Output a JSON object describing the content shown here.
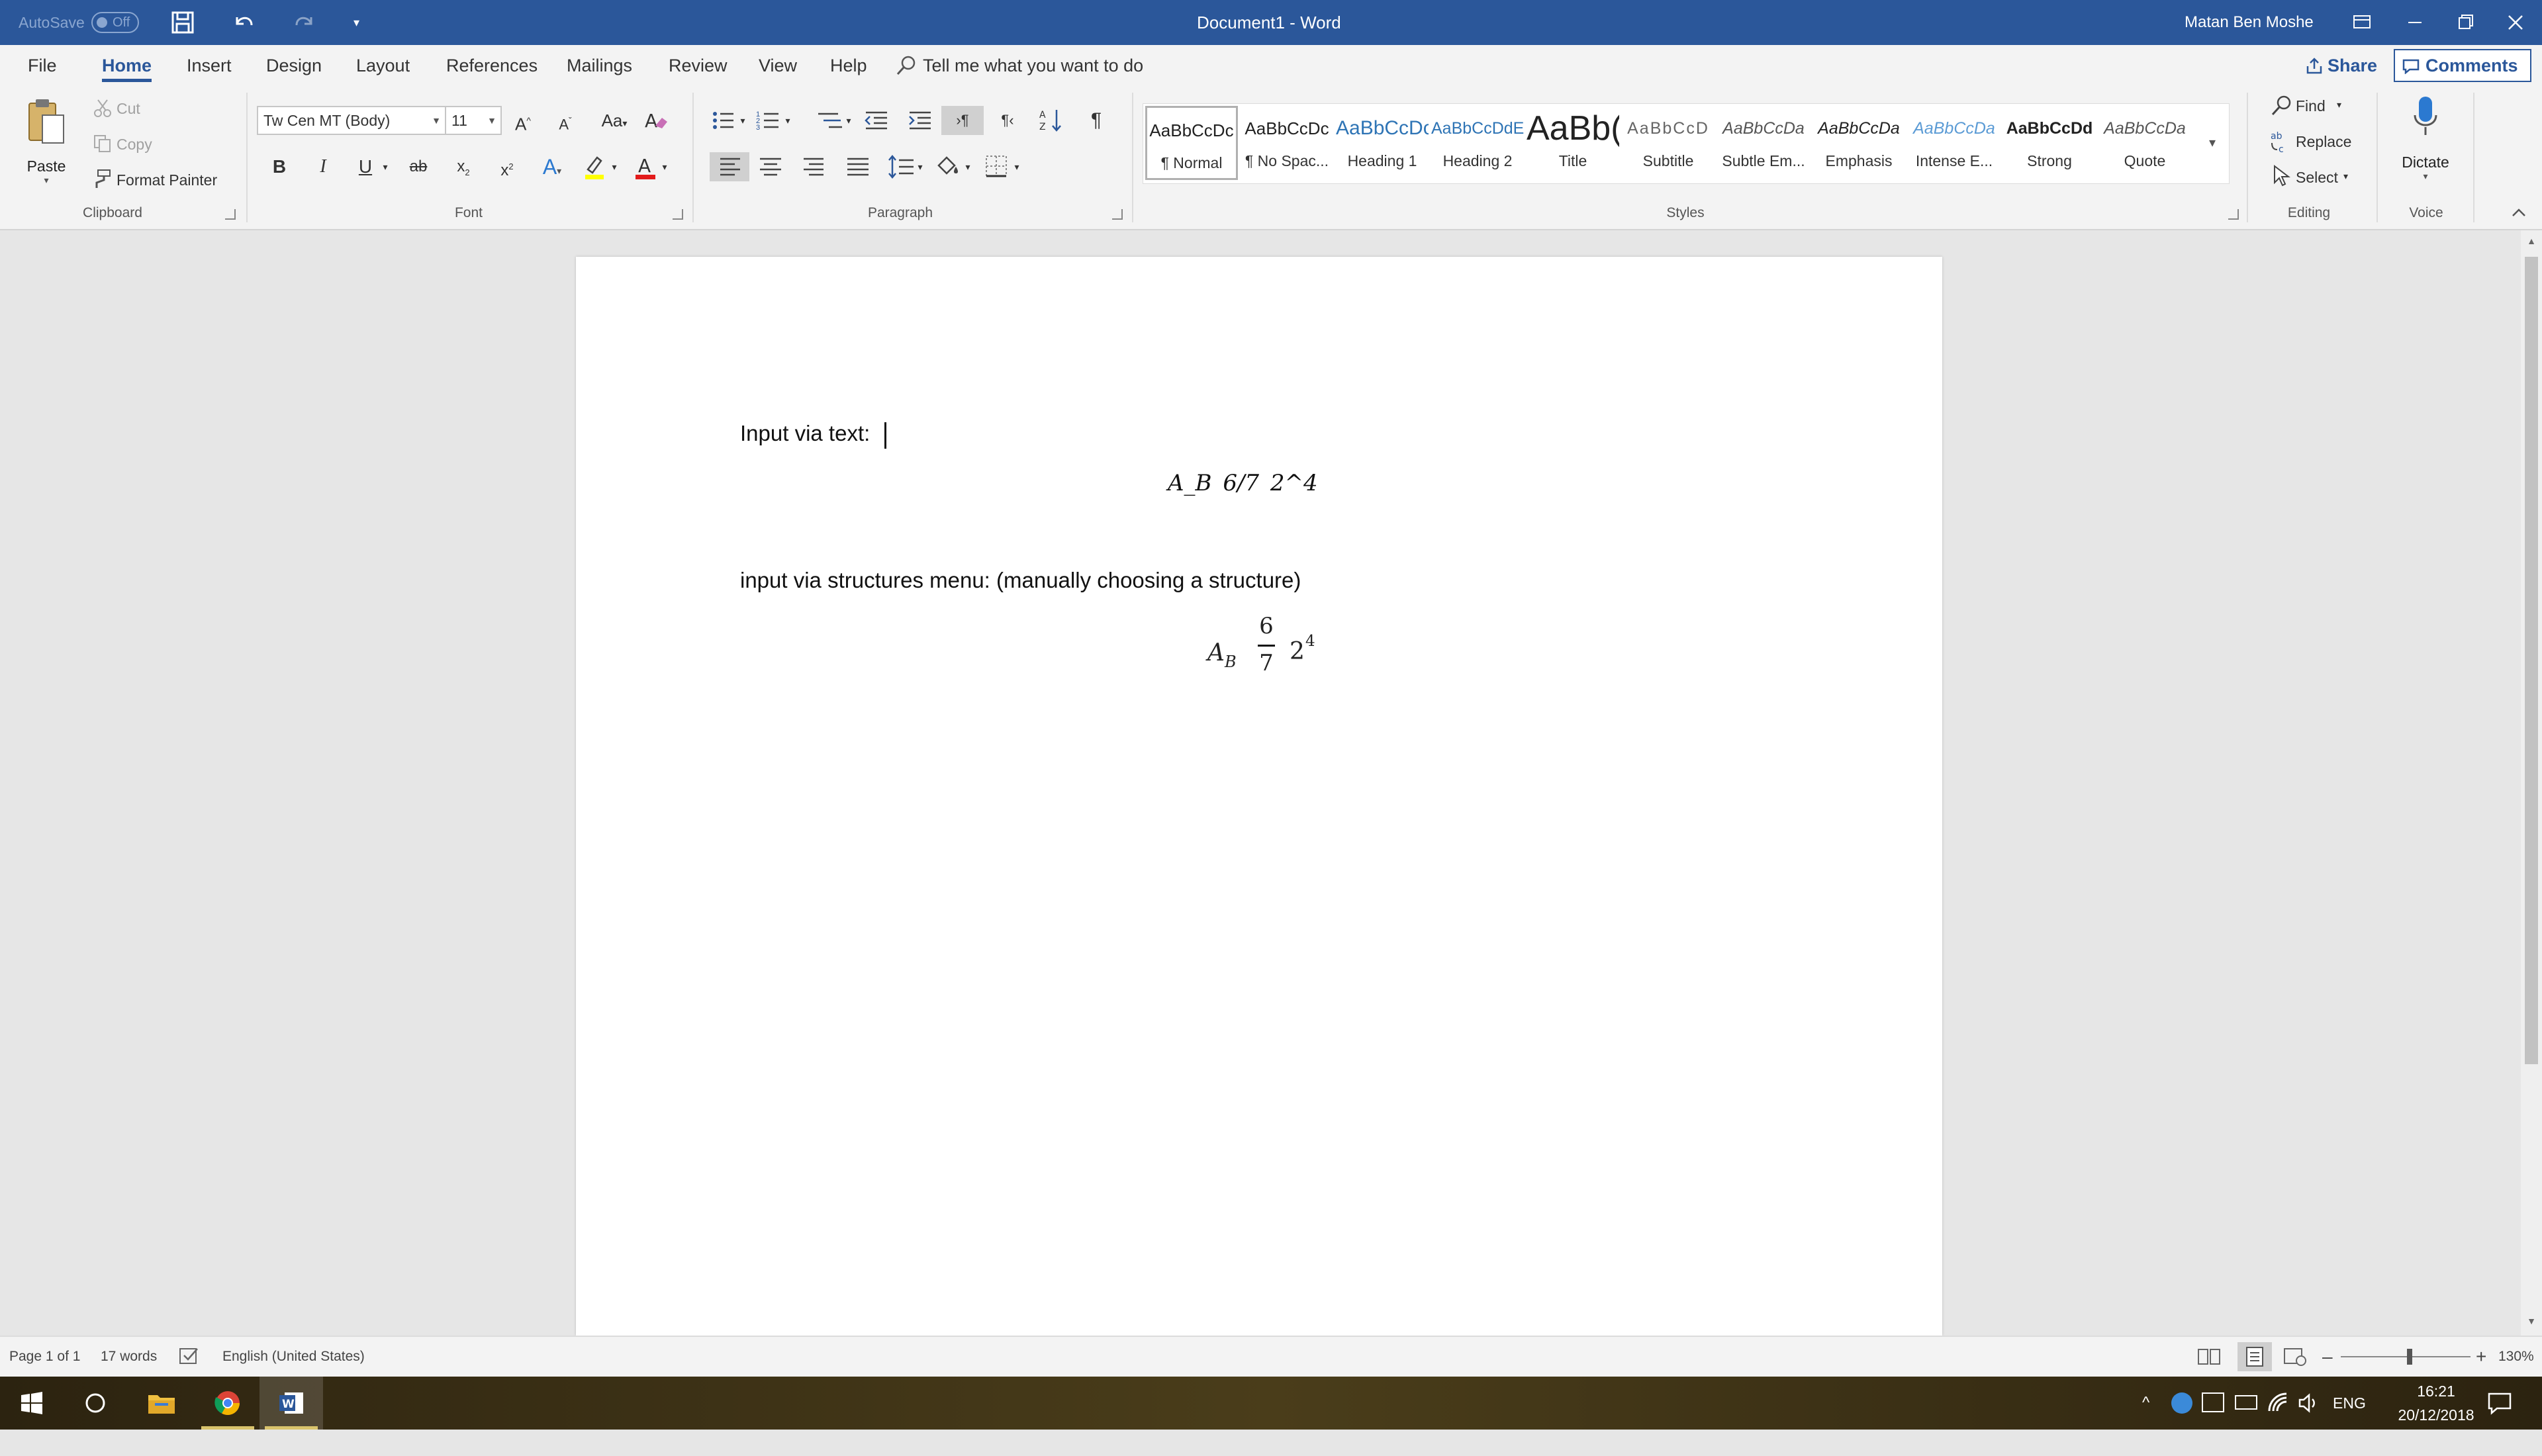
{
  "titlebar": {
    "autosave_label": "AutoSave",
    "autosave_state": "Off",
    "document_title": "Document1  -  Word",
    "user_name": "Matan Ben Moshe"
  },
  "tabs": [
    {
      "label": "File"
    },
    {
      "label": "Home",
      "active": true
    },
    {
      "label": "Insert"
    },
    {
      "label": "Design"
    },
    {
      "label": "Layout"
    },
    {
      "label": "References"
    },
    {
      "label": "Mailings"
    },
    {
      "label": "Review"
    },
    {
      "label": "View"
    },
    {
      "label": "Help"
    }
  ],
  "tell_me": "Tell me what you want to do",
  "share_label": "Share",
  "comments_label": "Comments",
  "clipboard": {
    "paste": "Paste",
    "cut": "Cut",
    "copy": "Copy",
    "format_painter": "Format Painter",
    "group": "Clipboard"
  },
  "font": {
    "family": "Tw Cen MT (Body)",
    "size": "11",
    "group": "Font",
    "bold": "B",
    "italic": "I",
    "underline": "U",
    "strike": "ab",
    "sub": "x",
    "sup": "x"
  },
  "paragraph": {
    "group": "Paragraph"
  },
  "styles": {
    "group": "Styles",
    "items": [
      {
        "preview": "AaBbCcDc",
        "name": "¶ Normal"
      },
      {
        "preview": "AaBbCcDc",
        "name": "¶ No Spac..."
      },
      {
        "preview": "AaBbCcDc",
        "name": "Heading 1"
      },
      {
        "preview": "AaBbCcDdEe",
        "name": "Heading 2"
      },
      {
        "preview": "AaBb(",
        "name": "Title"
      },
      {
        "preview": "AaBbCcD",
        "name": "Subtitle"
      },
      {
        "preview": "AaBbCcDa",
        "name": "Subtle Em..."
      },
      {
        "preview": "AaBbCcDa",
        "name": "Emphasis"
      },
      {
        "preview": "AaBbCcDa",
        "name": "Intense E..."
      },
      {
        "preview": "AaBbCcDd",
        "name": "Strong"
      },
      {
        "preview": "AaBbCcDa",
        "name": "Quote"
      }
    ]
  },
  "editing": {
    "find": "Find",
    "replace": "Replace",
    "select": "Select",
    "group": "Editing"
  },
  "voice": {
    "dictate": "Dictate",
    "group": "Voice"
  },
  "document": {
    "line1": "Input via text: ",
    "eq1": "A_B   6/7   2^4",
    "line2": "input via structures menu: (manually choosing a structure)",
    "eq2": {
      "base": "A",
      "sub": "B",
      "num": "6",
      "den": "7",
      "pow_base": "2",
      "pow_exp": "4"
    }
  },
  "status": {
    "page": "Page 1 of 1",
    "words": "17 words",
    "language": "English (United States)",
    "zoom": "130%"
  },
  "taskbar": {
    "lang": "ENG",
    "time": "16:21",
    "date": "20/12/2018"
  },
  "colors": {
    "accent": "#2b579a",
    "heading_blue": "#2e74b5",
    "intense_blue": "#5b9bd5"
  }
}
